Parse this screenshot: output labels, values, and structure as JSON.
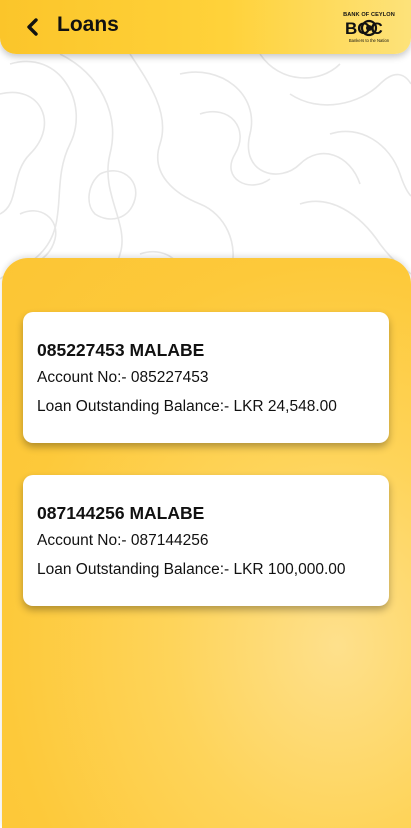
{
  "header": {
    "title": "Loans",
    "logo": {
      "top_text": "BANK OF CEYLON",
      "mark_text": "BOC",
      "tagline": "Bankers to the Nation"
    }
  },
  "colors": {
    "accent": "#fcc72e",
    "accent_light": "#fee08c",
    "card_bg": "#ffffff",
    "text": "#111111"
  },
  "loans": [
    {
      "title": "085227453 MALABE",
      "account": "Account No:- 085227453",
      "balance": "Loan Outstanding Balance:- LKR 24,548.00"
    },
    {
      "title": "087144256 MALABE",
      "account": "Account No:- 087144256",
      "balance": "Loan Outstanding Balance:- LKR 100,000.00"
    }
  ]
}
